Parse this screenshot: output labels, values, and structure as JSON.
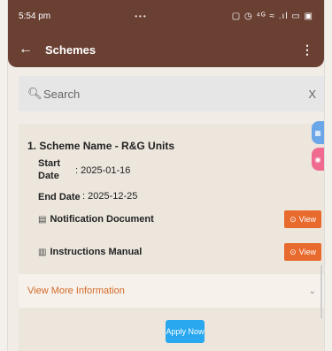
{
  "status": {
    "time": "5:54 pm",
    "dots": "•••",
    "icons": "▢ ◷ ⁴ᴳ ≈ .ıl ▭ ▣"
  },
  "app_bar": {
    "back_icon": "←",
    "title": "Schemes",
    "menu_icon": "⋮"
  },
  "search": {
    "icon": "🔍︎",
    "placeholder": "Search",
    "clear": "X"
  },
  "scheme": {
    "title": "1. Scheme Name -  R&G Units",
    "start_label_1": "Start",
    "start_label_2": "Date",
    "start_value": ": 2025-01-16",
    "end_label": "End Date",
    "end_value": ": 2025-12-25",
    "documents": [
      {
        "icon": "▤",
        "label": "Notification Document",
        "button": "View"
      },
      {
        "icon": "▥",
        "label": "Instructions Manual",
        "button": "View"
      }
    ],
    "more_info": "View More Information",
    "more_info_chevron": "⌄",
    "apply": "Apply Now"
  },
  "side_tabs": [
    {
      "icon": "▦",
      "color": "#6aa6e8"
    },
    {
      "icon": "◉",
      "color": "#f06a8f"
    }
  ]
}
